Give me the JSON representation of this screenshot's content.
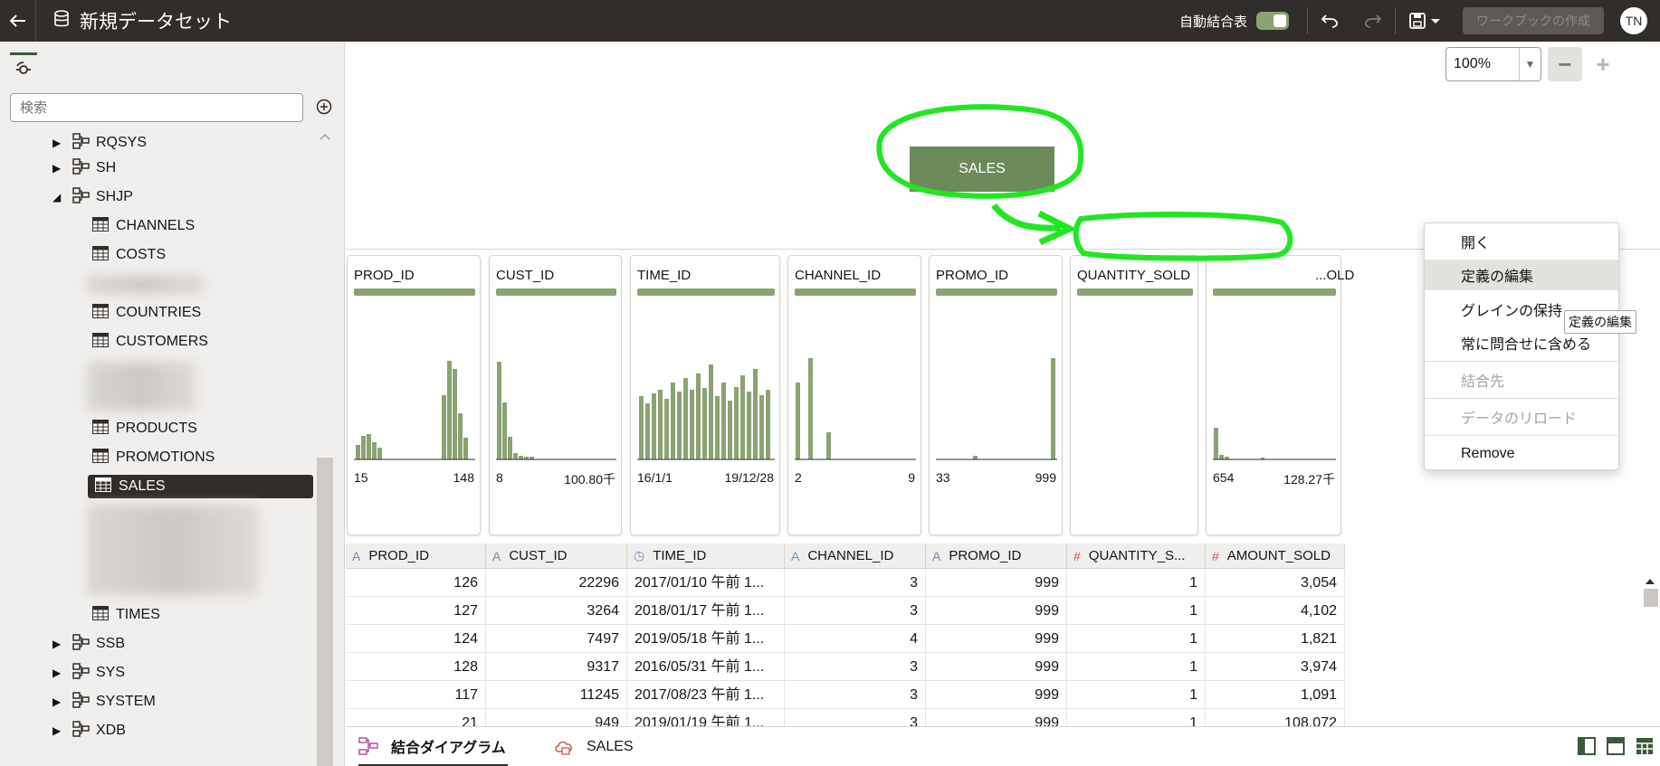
{
  "header": {
    "title": "新規データセット",
    "auto_join_label": "自動結合表",
    "create_workbook_label": "ワークブックの作成",
    "avatar_initials": "TN"
  },
  "sidebar": {
    "search_placeholder": "検索",
    "schemas": [
      {
        "name": "RQSYS",
        "expanded": false
      },
      {
        "name": "SH",
        "expanded": false
      },
      {
        "name": "SHJP",
        "expanded": true
      },
      {
        "name": "SSB",
        "expanded": false
      },
      {
        "name": "SYS",
        "expanded": false
      },
      {
        "name": "SYSTEM",
        "expanded": false
      },
      {
        "name": "XDB",
        "expanded": false
      }
    ],
    "shjp_tables": [
      "CHANNELS",
      "COSTS",
      "COUNTRIES",
      "CUSTOMERS",
      "PRODUCTS",
      "PROMOTIONS",
      "SALES",
      "TIMES"
    ],
    "selected_table": "SALES"
  },
  "diagram": {
    "zoom": "100%",
    "node_label": "SALES"
  },
  "context_menu": {
    "items": [
      "開く",
      "定義の編集",
      "グレインの保持",
      "常に問合せに含める",
      "結合先",
      "データのリロード",
      "Remove"
    ],
    "highlighted": "定義の編集",
    "disabled": [
      "結合先",
      "データのリロード"
    ],
    "tooltip": "定義の編集"
  },
  "profiles": [
    {
      "title": "PROD_ID",
      "min": "15",
      "max": "148"
    },
    {
      "title": "CUST_ID",
      "min": "8",
      "max": "100.80千"
    },
    {
      "title": "TIME_ID",
      "min": "16/1/1",
      "max": "19/12/28"
    },
    {
      "title": "CHANNEL_ID",
      "min": "2",
      "max": "9"
    },
    {
      "title": "PROMO_ID",
      "min": "33",
      "max": "999"
    },
    {
      "title": "QUANTITY_SOLD",
      "min": "",
      "max": ""
    },
    {
      "title": "AMOUNT_SOLD",
      "title_visible": "...OLD",
      "min": "654",
      "max": "128.27千"
    }
  ],
  "columns": [
    {
      "label": "PROD_ID",
      "type": "A"
    },
    {
      "label": "CUST_ID",
      "type": "A"
    },
    {
      "label": "TIME_ID",
      "type": "clock"
    },
    {
      "label": "CHANNEL_ID",
      "type": "A"
    },
    {
      "label": "PROMO_ID",
      "type": "A"
    },
    {
      "label": "QUANTITY_S...",
      "type": "#"
    },
    {
      "label": "AMOUNT_SOLD",
      "type": "#"
    }
  ],
  "rows": [
    [
      "126",
      "22296",
      "2017/01/10 午前 1...",
      "3",
      "999",
      "1",
      "3,054"
    ],
    [
      "127",
      "3264",
      "2018/01/17 午前 1...",
      "3",
      "999",
      "1",
      "4,102"
    ],
    [
      "124",
      "7497",
      "2019/05/18 午前 1...",
      "4",
      "999",
      "1",
      "1,821"
    ],
    [
      "128",
      "9317",
      "2016/05/31 午前 1...",
      "3",
      "999",
      "1",
      "3,974"
    ],
    [
      "117",
      "11245",
      "2017/08/23 午前 1...",
      "3",
      "999",
      "1",
      "1,091"
    ],
    [
      "21",
      "949",
      "2019/01/19 午前 1...",
      "3",
      "999",
      "1",
      "108,072"
    ]
  ],
  "bottom_tabs": [
    "結合ダイアグラム",
    "SALES"
  ],
  "colors": {
    "topbar": "#312d2a",
    "accent_green": "#8aa373",
    "node_green": "#6c8a5a",
    "annotation_green": "#22e622"
  }
}
